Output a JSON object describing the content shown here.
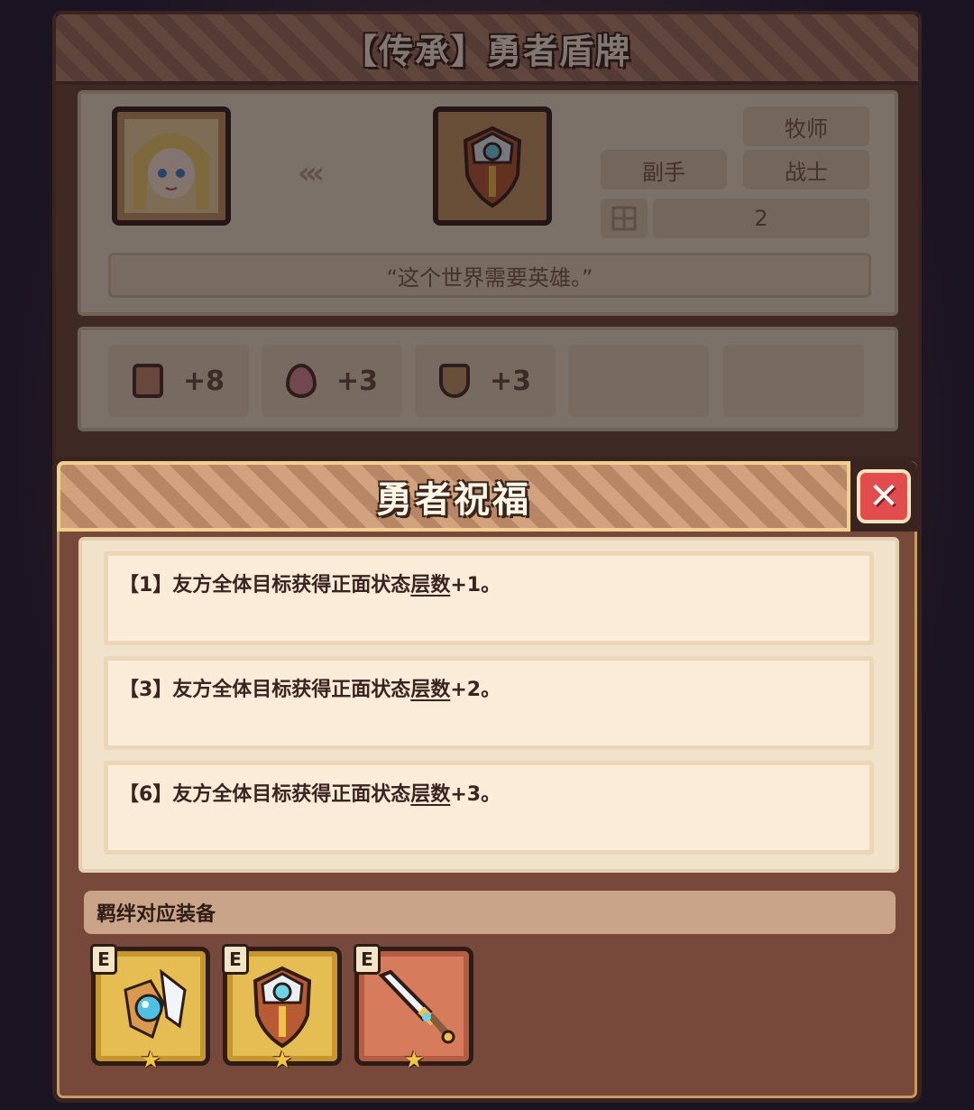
{
  "item_panel": {
    "title": "【传承】勇者盾牌",
    "tags": {
      "class_1": "牧师",
      "slot": "副手",
      "class_2": "战士"
    },
    "slot_count": "2",
    "quote": "“这个世界需要英雄。”",
    "stats": [
      {
        "icon": "fist-icon",
        "value": "+8"
      },
      {
        "icon": "heart-icon",
        "value": "+3"
      },
      {
        "icon": "shield-icon",
        "value": "+3"
      }
    ]
  },
  "dialog": {
    "title": "勇者祝福",
    "close_icon": "✕",
    "effects": [
      {
        "prefix": "【1】友方全体目标获得正面状态",
        "keyword": "层数",
        "suffix": "+1。"
      },
      {
        "prefix": "【3】友方全体目标获得正面状态",
        "keyword": "层数",
        "suffix": "+2。"
      },
      {
        "prefix": "【6】友方全体目标获得正面状态",
        "keyword": "层数",
        "suffix": "+3。"
      }
    ],
    "equip_header": "羁绊对应装备",
    "equipment": [
      {
        "badge": "E",
        "icon": "winged-orb-icon",
        "stars": "★"
      },
      {
        "badge": "E",
        "icon": "hero-shield-icon",
        "stars": "★"
      },
      {
        "badge": "E",
        "icon": "sword-icon",
        "stars": "★"
      }
    ]
  },
  "colors": {
    "panel_brown": "#76493a",
    "parchment": "#f0e2cb",
    "close_red": "#e24c4c",
    "gold_frame": "#e6bd52"
  }
}
